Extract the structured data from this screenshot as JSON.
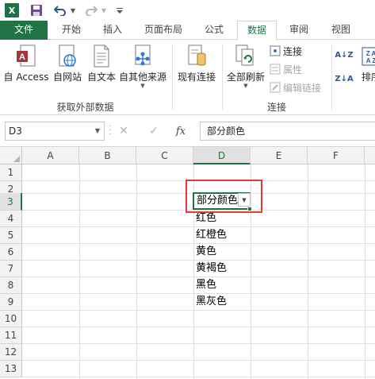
{
  "qat": {
    "excel_logo": "X",
    "icons": [
      "excel-logo-icon",
      "save-icon",
      "undo-icon",
      "redo-icon",
      "customize-qat-icon"
    ]
  },
  "tabs": [
    {
      "label": "文件"
    },
    {
      "label": "开始"
    },
    {
      "label": "插入"
    },
    {
      "label": "页面布局"
    },
    {
      "label": "公式"
    },
    {
      "label": "数据"
    },
    {
      "label": "审阅"
    },
    {
      "label": "视图"
    }
  ],
  "ribbon": {
    "external_data": {
      "buttons": [
        {
          "label": "自 Access",
          "icon": "access-database-icon"
        },
        {
          "label": "自网站",
          "icon": "web-globe-icon"
        },
        {
          "label": "自文本",
          "icon": "text-file-icon"
        },
        {
          "label": "自其他来源",
          "icon": "other-sources-icon"
        }
      ],
      "group_label": "获取外部数据"
    },
    "existing_connections": {
      "label": "现有连接",
      "icon": "existing-connections-icon"
    },
    "connections": {
      "refresh_all": {
        "label": "全部刷新",
        "icon": "refresh-all-icon"
      },
      "small": [
        {
          "label": "连接",
          "icon": "connections-icon",
          "enabled": true
        },
        {
          "label": "属性",
          "icon": "properties-icon",
          "enabled": false
        },
        {
          "label": "编辑链接",
          "icon": "edit-links-icon",
          "enabled": false
        }
      ],
      "group_label": "连接"
    },
    "sort": {
      "az_label": "A↓Z",
      "za_label": "Z↓A",
      "sort_label": "排序"
    }
  },
  "formula_bar": {
    "name_box": "D3",
    "cancel": "✕",
    "enter": "✓",
    "fx": "fx",
    "content": "部分颜色"
  },
  "grid": {
    "columns": [
      "A",
      "B",
      "C",
      "D",
      "E",
      "F"
    ],
    "selected_column": "D",
    "rows": [
      "1",
      "2",
      "3",
      "4",
      "5",
      "6",
      "7",
      "8",
      "9",
      "10",
      "11",
      "12",
      "13"
    ],
    "selected_row": "3",
    "active_cell_text": "部分颜色",
    "d_values": [
      {
        "row": "4",
        "text": "红色"
      },
      {
        "row": "5",
        "text": "红橙色"
      },
      {
        "row": "6",
        "text": "黄色"
      },
      {
        "row": "7",
        "text": "黄褐色"
      },
      {
        "row": "8",
        "text": "黑色"
      },
      {
        "row": "9",
        "text": "黑灰色"
      }
    ]
  },
  "colors": {
    "accent": "#217346",
    "highlight_box": "#e53935"
  }
}
